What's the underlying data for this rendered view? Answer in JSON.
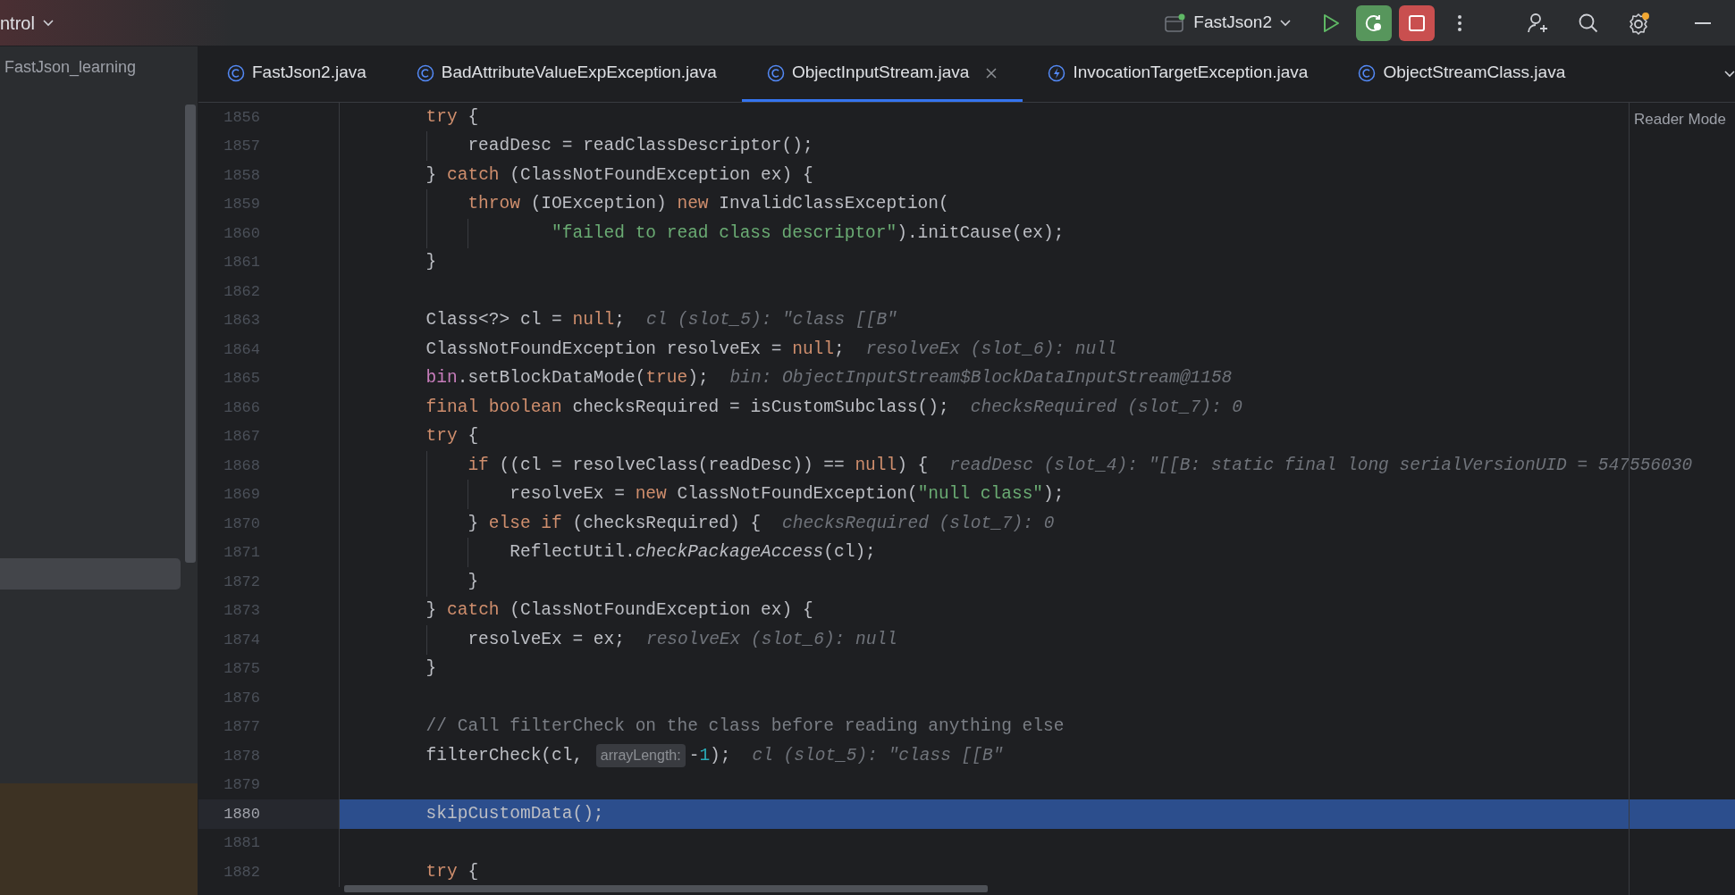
{
  "top_bar": {
    "vcs_label": "ntrol",
    "run_config": "FastJson2",
    "debug_active": true,
    "settings_badge": true
  },
  "project_panel": {
    "path_label": "FastJson_learning",
    "highlighted_row": true
  },
  "tabs": [
    {
      "label": "FastJson2.java",
      "kind": "class",
      "selected": false
    },
    {
      "label": "BadAttributeValueExpException.java",
      "kind": "class",
      "selected": false
    },
    {
      "label": "ObjectInputStream.java",
      "kind": "class",
      "selected": true
    },
    {
      "label": "InvocationTargetException.java",
      "kind": "exception",
      "selected": false
    },
    {
      "label": "ObjectStreamClass.java",
      "kind": "class",
      "selected": false
    }
  ],
  "editor": {
    "reader_mode": "Reader Mode",
    "lines": [
      {
        "number": "1856",
        "selected": false,
        "tokens": [
          {
            "kind": "keyword",
            "text": "        try"
          },
          {
            "kind": "plain",
            "text": " {"
          }
        ]
      },
      {
        "number": "1857",
        "selected": false,
        "tokens": [
          {
            "kind": "plain",
            "text": "            readDesc = readClassDescriptor();"
          }
        ]
      },
      {
        "number": "1858",
        "selected": false,
        "tokens": [
          {
            "kind": "plain",
            "text": "        } "
          },
          {
            "kind": "keyword",
            "text": "catch"
          },
          {
            "kind": "plain",
            "text": " (ClassNotFoundException ex) {"
          }
        ]
      },
      {
        "number": "1859",
        "selected": false,
        "tokens": [
          {
            "kind": "keyword",
            "text": "            throw"
          },
          {
            "kind": "plain",
            "text": " (IOException) "
          },
          {
            "kind": "keyword",
            "text": "new"
          },
          {
            "kind": "plain",
            "text": " InvalidClassException("
          }
        ]
      },
      {
        "number": "1860",
        "selected": false,
        "tokens": [
          {
            "kind": "string",
            "text": "                    \"failed to read class descriptor\""
          },
          {
            "kind": "plain",
            "text": ").initCause(ex);"
          }
        ]
      },
      {
        "number": "1861",
        "selected": false,
        "tokens": [
          {
            "kind": "plain",
            "text": "        }"
          }
        ]
      },
      {
        "number": "1862",
        "selected": false
      },
      {
        "number": "1863",
        "selected": false,
        "tokens": [
          {
            "kind": "plain",
            "text": "        Class<?> cl = "
          },
          {
            "kind": "keyword",
            "text": "null"
          },
          {
            "kind": "plain",
            "text": ";"
          },
          {
            "kind": "debug_value",
            "text": "cl (slot_5): \"class [[B\""
          }
        ]
      },
      {
        "number": "1864",
        "selected": false,
        "tokens": [
          {
            "kind": "plain",
            "text": "        ClassNotFoundException resolveEx = "
          },
          {
            "kind": "keyword",
            "text": "null"
          },
          {
            "kind": "plain",
            "text": ";"
          },
          {
            "kind": "debug_value",
            "text": "resolveEx (slot_6): null"
          }
        ]
      },
      {
        "number": "1865",
        "selected": false,
        "tokens": [
          {
            "kind": "field",
            "text": "        bin"
          },
          {
            "kind": "plain",
            "text": ".setBlockDataMode("
          },
          {
            "kind": "keyword",
            "text": "true"
          },
          {
            "kind": "plain",
            "text": ");"
          },
          {
            "kind": "debug_value",
            "text": "bin: ObjectInputStream$BlockDataInputStream@1158"
          }
        ]
      },
      {
        "number": "1866",
        "selected": false,
        "tokens": [
          {
            "kind": "keyword",
            "text": "        final boolean"
          },
          {
            "kind": "plain",
            "text": " checksRequired = isCustomSubclass();"
          },
          {
            "kind": "debug_value",
            "text": "checksRequired (slot_7): 0"
          }
        ]
      },
      {
        "number": "1867",
        "selected": false,
        "tokens": [
          {
            "kind": "keyword",
            "text": "        try"
          },
          {
            "kind": "plain",
            "text": " {"
          }
        ]
      },
      {
        "number": "1868",
        "selected": false,
        "tokens": [
          {
            "kind": "keyword",
            "text": "            if"
          },
          {
            "kind": "plain",
            "text": " ((cl = resolveClass(readDesc)) == "
          },
          {
            "kind": "keyword",
            "text": "null"
          },
          {
            "kind": "plain",
            "text": ") {"
          },
          {
            "kind": "debug_value",
            "text": "readDesc (slot_4): \"[[B: static final long serialVersionUID = 547556030"
          }
        ]
      },
      {
        "number": "1869",
        "selected": false,
        "tokens": [
          {
            "kind": "plain",
            "text": "                resolveEx = "
          },
          {
            "kind": "keyword",
            "text": "new"
          },
          {
            "kind": "plain",
            "text": " ClassNotFoundException("
          },
          {
            "kind": "string",
            "text": "\"null class\""
          },
          {
            "kind": "plain",
            "text": ");"
          }
        ]
      },
      {
        "number": "1870",
        "selected": false,
        "tokens": [
          {
            "kind": "plain",
            "text": "            } "
          },
          {
            "kind": "keyword",
            "text": "else if"
          },
          {
            "kind": "plain",
            "text": " (checksRequired) {"
          },
          {
            "kind": "debug_value",
            "text": "checksRequired (slot_7): 0"
          }
        ]
      },
      {
        "number": "1871",
        "selected": false,
        "tokens": [
          {
            "kind": "plain",
            "text": "                ReflectUtil."
          },
          {
            "kind": "static_method",
            "text": "checkPackageAccess"
          },
          {
            "kind": "plain",
            "text": "(cl);"
          }
        ]
      },
      {
        "number": "1872",
        "selected": false,
        "tokens": [
          {
            "kind": "plain",
            "text": "            }"
          }
        ]
      },
      {
        "number": "1873",
        "selected": false,
        "tokens": [
          {
            "kind": "plain",
            "text": "        } "
          },
          {
            "kind": "keyword",
            "text": "catch"
          },
          {
            "kind": "plain",
            "text": " (ClassNotFoundException ex) {"
          }
        ]
      },
      {
        "number": "1874",
        "selected": false,
        "tokens": [
          {
            "kind": "plain",
            "text": "            resolveEx = ex;"
          },
          {
            "kind": "debug_value",
            "text": "resolveEx (slot_6): null"
          }
        ]
      },
      {
        "number": "1875",
        "selected": false,
        "tokens": [
          {
            "kind": "plain",
            "text": "        }"
          }
        ]
      },
      {
        "number": "1876",
        "selected": false
      },
      {
        "number": "1877",
        "selected": false,
        "tokens": [
          {
            "kind": "comment",
            "text": "        // Call filterCheck on the class before reading anything else"
          }
        ]
      },
      {
        "number": "1878",
        "selected": false,
        "tokens": [
          {
            "kind": "plain",
            "text": "        filterCheck(cl, "
          },
          {
            "kind": "param_hint",
            "text": "arrayLength:"
          },
          {
            "kind": "plain",
            "text": "-"
          },
          {
            "kind": "number",
            "text": "1"
          },
          {
            "kind": "plain",
            "text": ");"
          },
          {
            "kind": "debug_value",
            "text": "cl (slot_5): \"class [[B\""
          }
        ]
      },
      {
        "number": "1879",
        "selected": false
      },
      {
        "number": "1880",
        "selected": true,
        "tokens": [
          {
            "kind": "plain",
            "text": "        skipCustomData();"
          }
        ]
      },
      {
        "number": "1881",
        "selected": false
      },
      {
        "number": "1882",
        "selected": false,
        "tokens": [
          {
            "kind": "keyword",
            "text": "        try"
          },
          {
            "kind": "plain",
            "text": " {"
          }
        ]
      }
    ]
  }
}
